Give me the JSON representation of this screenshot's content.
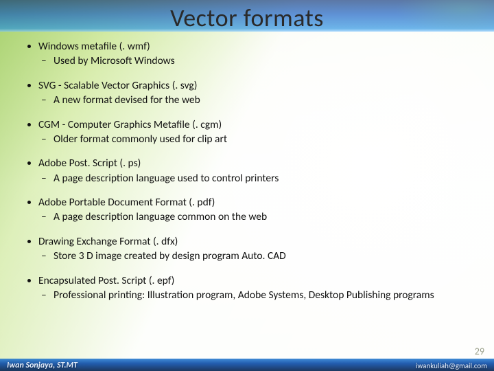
{
  "title": "Vector formats",
  "items": [
    {
      "head": "Windows metafile (. wmf)",
      "sub": "Used by Microsoft Windows"
    },
    {
      "head": "SVG - Scalable Vector Graphics (. svg)",
      "sub": "A new format devised for the web"
    },
    {
      "head": "CGM - Computer Graphics Metafile (. cgm)",
      "sub": "Older format commonly used for clip art"
    },
    {
      "head": "Adobe Post. Script (. ps)",
      "sub": "A page description language used to control printers"
    },
    {
      "head": "Adobe Portable Document Format (. pdf)",
      "sub": "A page description language common on the web"
    },
    {
      "head": "Drawing Exchange Format (. dfx)",
      "sub": "Store 3 D image created by design program Auto. CAD"
    },
    {
      "head": "Encapsulated Post. Script (. epf)",
      "sub": "Professional printing: Illustration program, Adobe Systems, Desktop Publishing programs"
    }
  ],
  "page_number": "29",
  "author": "Iwan Sonjaya, ST.MT",
  "email": "iwankuliah@gmail.com"
}
